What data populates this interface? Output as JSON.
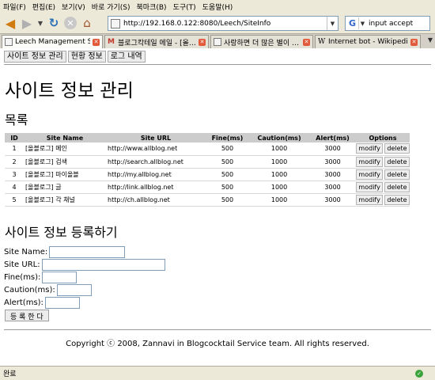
{
  "menu": [
    "파일(F)",
    "편집(E)",
    "보기(V)",
    "바로 가기(S)",
    "북마크(B)",
    "도구(T)",
    "도움말(H)"
  ],
  "address_bar": {
    "url": "http://192.168.0.122:8080/Leech/SiteInfo"
  },
  "search_bar": {
    "value": "input accept",
    "engine_icon": "G"
  },
  "tabs": [
    {
      "label": "Leech Management Sys…",
      "active": true
    },
    {
      "label": "블로그칵테일 메일 - [올…",
      "active": false
    },
    {
      "label": "사랑하면 더 많은 별이 …",
      "active": false
    },
    {
      "label": "Internet bot - Wikipedia, …",
      "active": false
    }
  ],
  "page_nav": {
    "site_info": "사이트 정보 관리",
    "status": "현황 정보",
    "logs": "로그 내역"
  },
  "page_title": "사이트 정보 관리",
  "list_heading": "목록",
  "table": {
    "headers": {
      "id": "ID",
      "name": "Site Name",
      "url": "Site URL",
      "fine": "Fine(ms)",
      "caution": "Caution(ms)",
      "alert": "Alert(ms)",
      "options": "Options"
    },
    "modify_label": "modify",
    "delete_label": "delete",
    "rows": [
      {
        "id": "1",
        "name": "[올블로그] 메인",
        "url": "http://www.allblog.net",
        "fine": "500",
        "caution": "1000",
        "alert": "3000"
      },
      {
        "id": "2",
        "name": "[올블로그] 검색",
        "url": "http://search.allblog.net",
        "fine": "500",
        "caution": "1000",
        "alert": "3000"
      },
      {
        "id": "3",
        "name": "[올블로그] 마이올블",
        "url": "http://my.allblog.net",
        "fine": "500",
        "caution": "1000",
        "alert": "3000"
      },
      {
        "id": "4",
        "name": "[올블로그] 글",
        "url": "http://link.allblog.net",
        "fine": "500",
        "caution": "1000",
        "alert": "3000"
      },
      {
        "id": "5",
        "name": "[올블로그] 각 채널",
        "url": "http://ch.allblog.net",
        "fine": "500",
        "caution": "1000",
        "alert": "3000"
      }
    ]
  },
  "form": {
    "heading": "사이트 정보 등록하기",
    "site_name_label": "Site Name:",
    "site_url_label": "Site URL:",
    "fine_label": "Fine(ms):",
    "caution_label": "Caution(ms):",
    "alert_label": "Alert(ms):",
    "submit_label": "등 록 한 다"
  },
  "footer": "Copyright ⓒ 2008, Zannavi in Blogcocktail Service team. All rights reserved.",
  "status_text": "완료"
}
